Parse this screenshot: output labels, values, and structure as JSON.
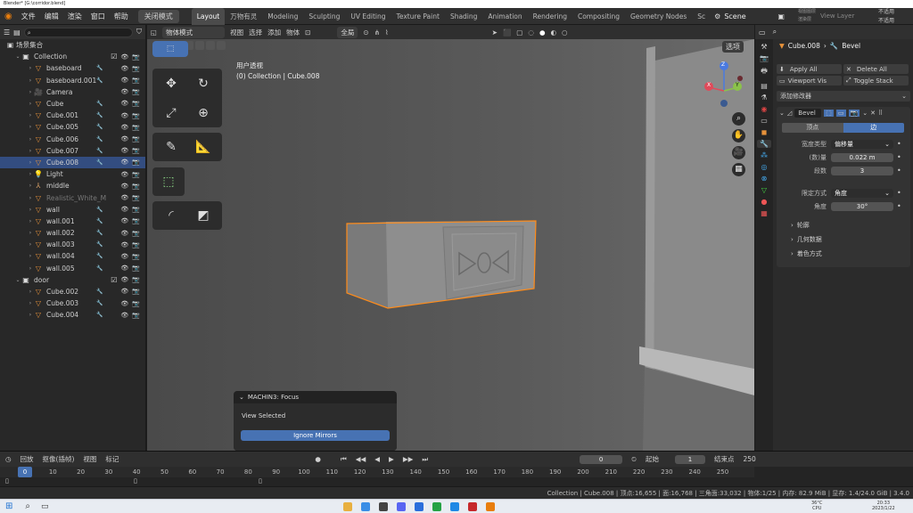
{
  "title": "Blender* [G:\\corridor.blend]",
  "menubar": {
    "menus": [
      "文件",
      "编辑",
      "渲染",
      "窗口",
      "帮助"
    ],
    "mode": "关闭模式",
    "scene": "Scene",
    "view_layer": "View Layer",
    "right_labels": [
      "不适用",
      "不适用"
    ],
    "right_small": [
      "视图图层",
      "渲染层"
    ]
  },
  "workspaces": [
    "Layout",
    "万物有灵",
    "Modeling",
    "Sculpting",
    "UV Editing",
    "Texture Paint",
    "Shading",
    "Animation",
    "Rendering",
    "Compositing",
    "Geometry Nodes",
    "Sc"
  ],
  "outliner": {
    "root": "场景集合",
    "rows": [
      {
        "label": "Collection",
        "kind": "collection"
      },
      {
        "label": "baseboard",
        "kind": "mesh"
      },
      {
        "label": "baseboard.001",
        "kind": "mesh"
      },
      {
        "label": "Camera",
        "kind": "camera"
      },
      {
        "label": "Cube",
        "kind": "mesh"
      },
      {
        "label": "Cube.001",
        "kind": "mesh"
      },
      {
        "label": "Cube.005",
        "kind": "mesh"
      },
      {
        "label": "Cube.006",
        "kind": "mesh"
      },
      {
        "label": "Cube.007",
        "kind": "mesh"
      },
      {
        "label": "Cube.008",
        "kind": "mesh",
        "selected": true
      },
      {
        "label": "Light",
        "kind": "light"
      },
      {
        "label": "middle",
        "kind": "empty"
      },
      {
        "label": "Realistic_White_M",
        "kind": "mesh",
        "dim": true
      },
      {
        "label": "wall",
        "kind": "mesh"
      },
      {
        "label": "wall.001",
        "kind": "mesh"
      },
      {
        "label": "wall.002",
        "kind": "mesh"
      },
      {
        "label": "wall.003",
        "kind": "mesh"
      },
      {
        "label": "wall.004",
        "kind": "mesh"
      },
      {
        "label": "wall.005",
        "kind": "mesh"
      },
      {
        "label": "door",
        "kind": "collection"
      },
      {
        "label": "Cube.002",
        "kind": "mesh"
      },
      {
        "label": "Cube.003",
        "kind": "mesh"
      },
      {
        "label": "Cube.004",
        "kind": "mesh"
      }
    ]
  },
  "viewport": {
    "header": [
      "物体模式",
      "视图",
      "选择",
      "添加",
      "物体",
      "全局"
    ],
    "options": "选项",
    "overlay_title": "用户透视",
    "overlay_sub": "(0) Collection | Cube.008",
    "gizmo_axes": [
      "Z",
      "X",
      "Y"
    ]
  },
  "popup": {
    "title": "MACHIN3: Focus",
    "label": "View Selected",
    "button": "Ignore Mirrors"
  },
  "properties": {
    "breadcrumb_obj": "Cube.008",
    "breadcrumb_mod": "Bevel",
    "apply_all": "Apply All",
    "delete_all": "Delete All",
    "viewport_vis": "Viewport Vis",
    "toggle_stack": "Toggle Stack",
    "add_modifier": "添加修改器",
    "modifier_name": "Bevel",
    "tab_vertex": "顶点",
    "tab_edge": "边",
    "width_type_label": "宽度类型",
    "width_type_value": "偏移量",
    "amount_label": "(数)量",
    "amount_value": "0.022 m",
    "segments_label": "段数",
    "segments_value": "3",
    "limit_label": "限定方式",
    "limit_value": "角度",
    "angle_label": "角度",
    "angle_value": "30°",
    "sections": [
      "轮廓",
      "几何数据",
      "着色方式"
    ]
  },
  "timeline": {
    "menus": [
      "回放",
      "抠像(插帧)",
      "视图",
      "标记"
    ],
    "current": "0",
    "start_label": "起始",
    "start": "1",
    "end_label": "结束点",
    "end": "250",
    "ticks": [
      "0",
      "10",
      "20",
      "30",
      "40",
      "50",
      "60",
      "70",
      "80",
      "90",
      "100",
      "110",
      "120",
      "130",
      "140",
      "150",
      "160",
      "170",
      "180",
      "190",
      "200",
      "210",
      "220",
      "230",
      "240",
      "250"
    ]
  },
  "status": "Collection | Cube.008 | 顶点:16,655 | 面:16,768 | 三角面:33,032 | 物体:1/25 | 内存: 82.9 MiB | 显存: 1.4/24.0 GiB | 3.4.0",
  "taskbar": {
    "weather": "36°C",
    "weather_sub": "CPU",
    "time": "20:33",
    "date": "2023/1/22"
  },
  "colors": {
    "accent": "#4772b3",
    "selected_row": "#334d80",
    "object_orange": "#e5913a",
    "outline": "#ff8c1a"
  }
}
